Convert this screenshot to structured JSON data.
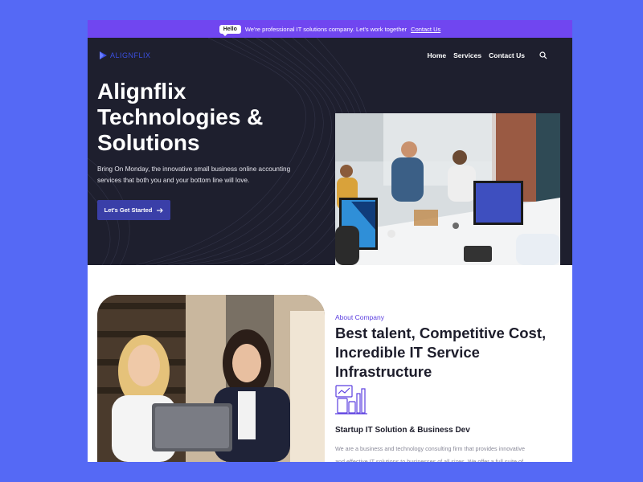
{
  "topbar": {
    "badge": "Hello",
    "message": "We're professional IT solutions company. Let's work together",
    "link": "Contact Us"
  },
  "header": {
    "logo_text": "ALIGNFLIX",
    "nav": [
      "Home",
      "Services",
      "Contact Us"
    ],
    "search_icon": "search-icon"
  },
  "hero": {
    "title": "Alignflix Technologies & Solutions",
    "subtitle": "Bring On Monday, the innovative small business online accounting services that both you and your bottom line will love.",
    "cta_label": "Let's Get Started",
    "cta_icon": "arrow-right-icon"
  },
  "about": {
    "eyebrow": "About Company",
    "heading": "Best talent, Competitive Cost, Incredible IT Service Infrastructure",
    "subheading": "Startup IT Solution & Business Dev",
    "description": "We are a business and technology consulting firm that provides innovative and effective IT solutions to businesses of all sizes. We offer a full suite of"
  },
  "colors": {
    "background": "#5569f5",
    "topbar": "#7046f0",
    "hero_bg": "#1e1f2e",
    "cta_bg": "#3a3fa8",
    "accent": "#5b3ee0"
  }
}
